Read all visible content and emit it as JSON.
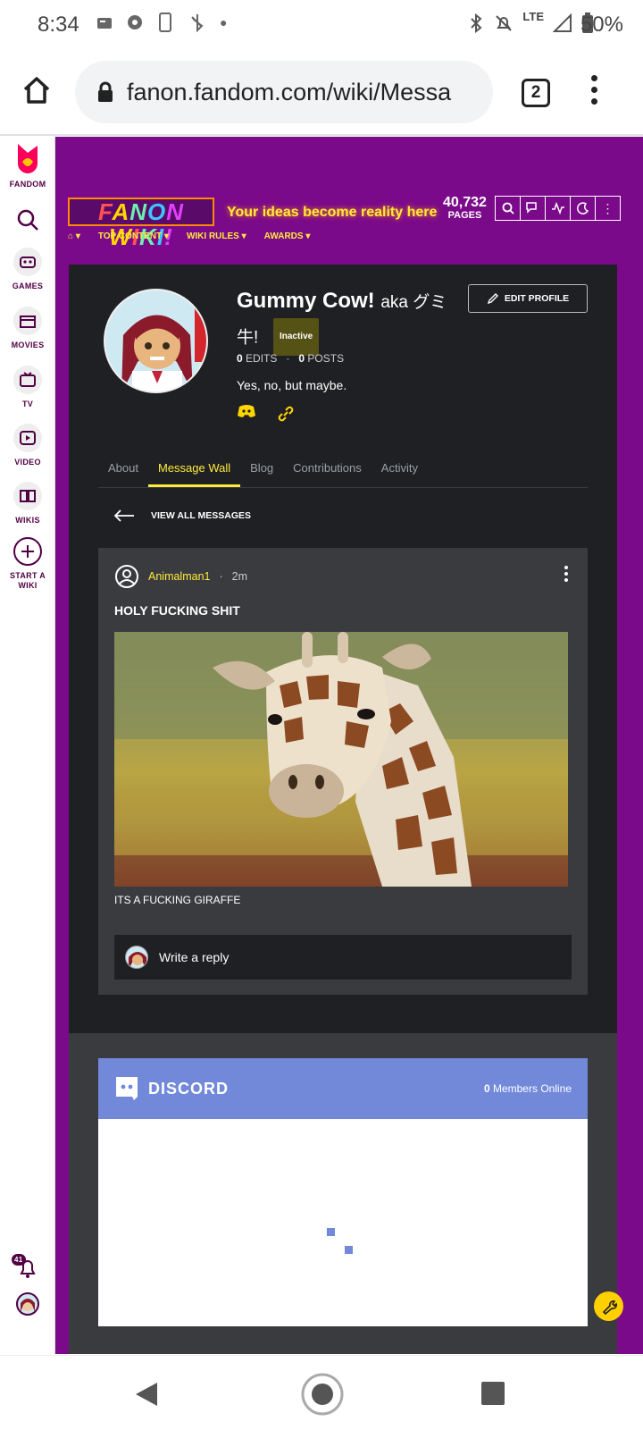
{
  "status_bar": {
    "time": "8:34",
    "network": "LTE",
    "battery": "50%"
  },
  "browser": {
    "url": "fanon.fandom.com/wiki/Messa",
    "tab_count": "2"
  },
  "left_rail": {
    "fandom_label": "FANDOM",
    "items": [
      {
        "label": "GAMES",
        "icon": "gamepad-icon"
      },
      {
        "label": "MOVIES",
        "icon": "clapperboard-icon"
      },
      {
        "label": "TV",
        "icon": "tv-icon"
      },
      {
        "label": "VIDEO",
        "icon": "video-icon"
      },
      {
        "label": "WIKIS",
        "icon": "book-icon"
      },
      {
        "label": "START A WIKI",
        "icon": "plus-icon"
      }
    ],
    "notif_count": "41"
  },
  "wiki": {
    "tagline": "Your ideas become reality here",
    "pages_count": "40,732",
    "pages_label": "PAGES",
    "nav": [
      "TOP CONTENT",
      "WIKI RULES",
      "AWARDS"
    ]
  },
  "profile": {
    "name": "Gummy Cow!",
    "aka": "aka グミ牛!",
    "status_badge": "Inactive",
    "edit_label": "EDIT PROFILE",
    "edits": "0",
    "edits_label": "EDITS",
    "posts": "0",
    "posts_label": "POSTS",
    "bio": "Yes, no, but maybe.",
    "tabs": [
      "About",
      "Message Wall",
      "Blog",
      "Contributions",
      "Activity"
    ],
    "active_tab": "Message Wall"
  },
  "message_wall": {
    "view_all": "VIEW ALL MESSAGES",
    "post": {
      "author": "Animalman1",
      "time": "2m",
      "title": "HOLY FUCKING SHIT",
      "caption": "ITS A FUCKING GIRAFFE",
      "reply_placeholder": "Write a reply"
    }
  },
  "discord": {
    "brand": "DISCORD",
    "members_count": "0",
    "members_label": "Members Online",
    "color": "#7289da"
  },
  "colors": {
    "site_bg": "#7b0a8a",
    "accent_yellow": "#ffeb3b",
    "card_bg": "#1f2023"
  }
}
